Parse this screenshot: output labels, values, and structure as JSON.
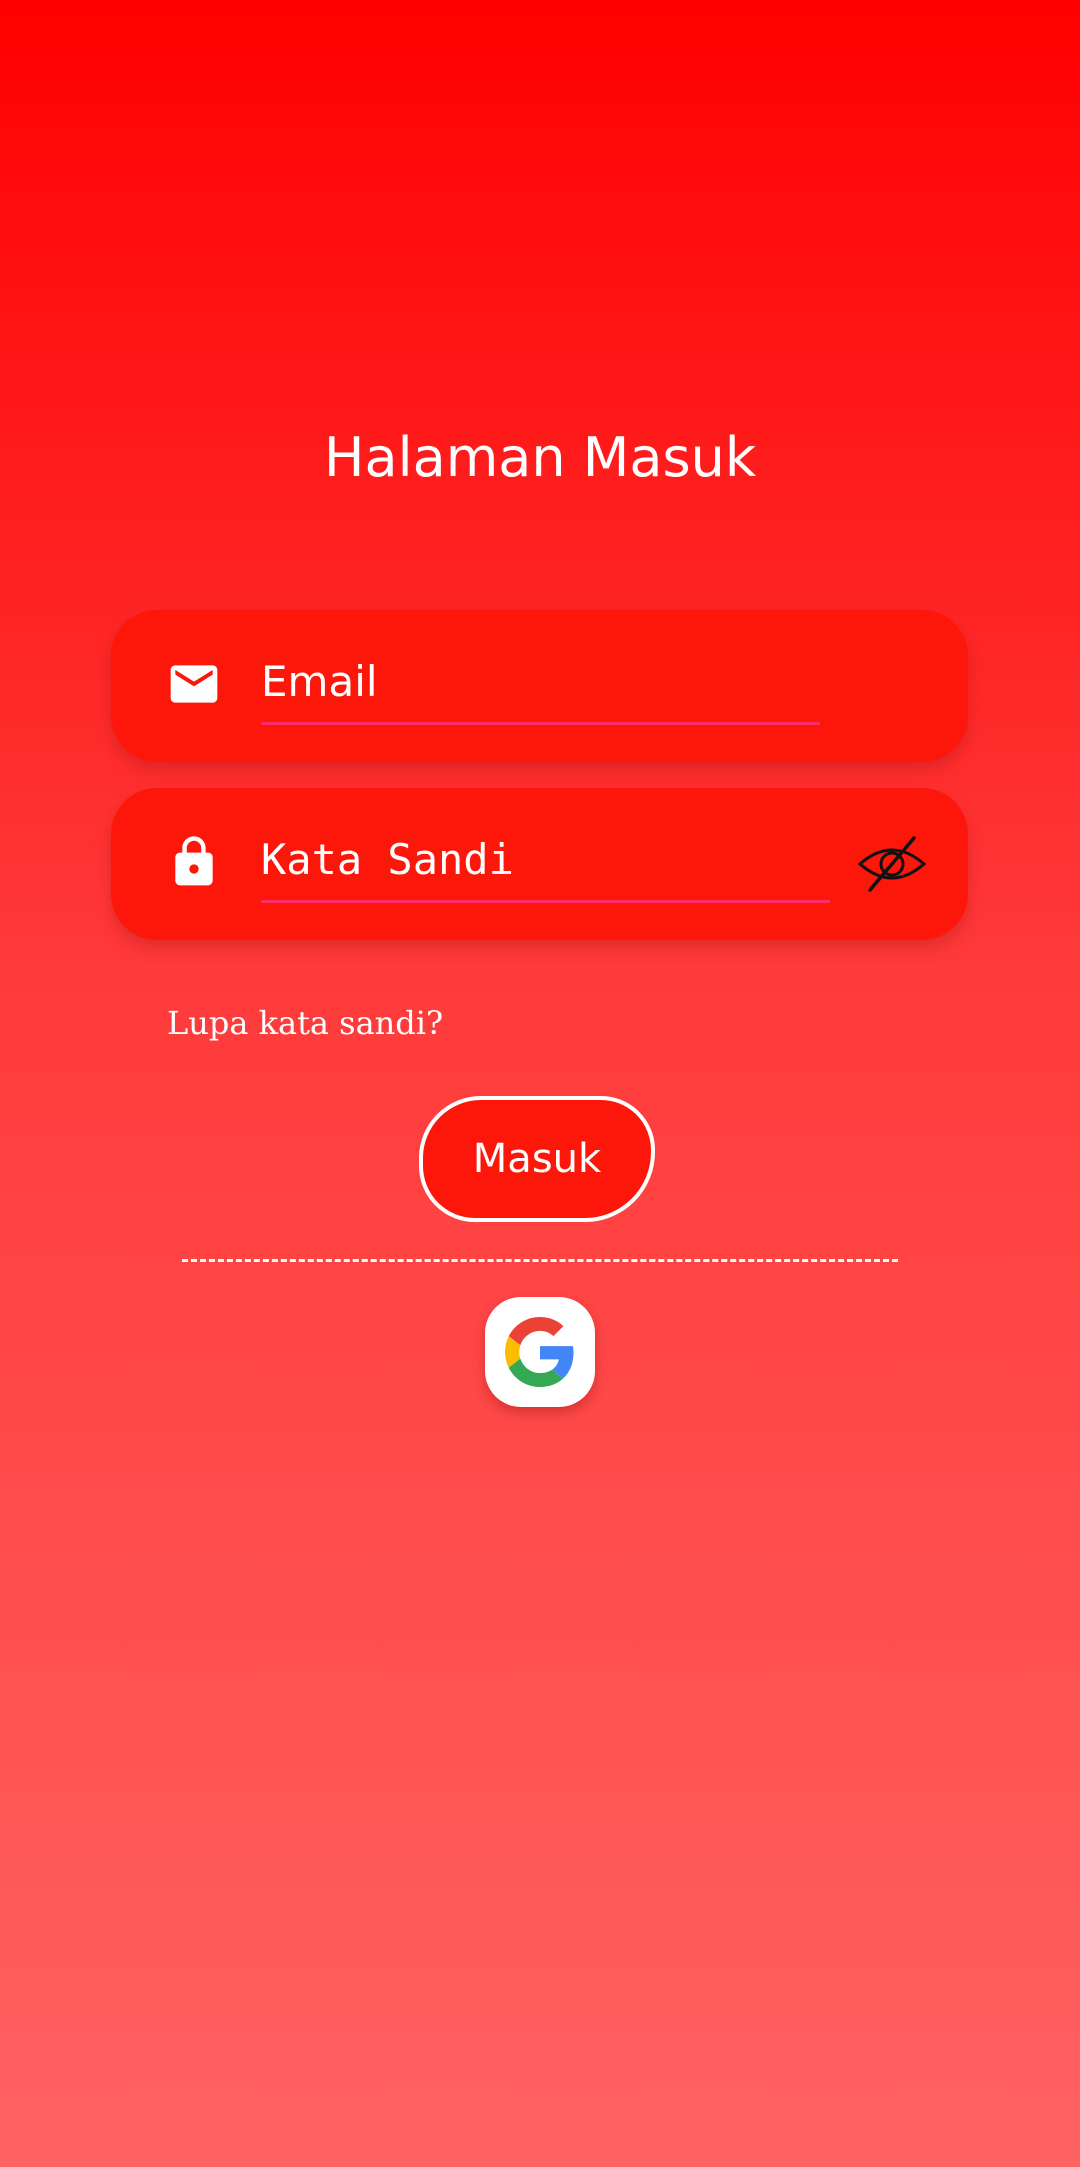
{
  "page": {
    "title": "Halaman Masuk"
  },
  "form": {
    "email_placeholder": "Email",
    "password_placeholder": "Kata Sandi",
    "forgot_password_label": "Lupa kata sandi?",
    "login_button_label": "Masuk"
  },
  "icons": {
    "email": "mail-icon",
    "password": "lock-icon",
    "visibility": "eye-off-icon",
    "google": "google-icon"
  },
  "colors": {
    "gradient_top": "#ff0000",
    "gradient_bottom": "#ff6262",
    "field_background": "#fd170a",
    "field_underline": "#ff2d6b",
    "text": "#ffffff"
  }
}
